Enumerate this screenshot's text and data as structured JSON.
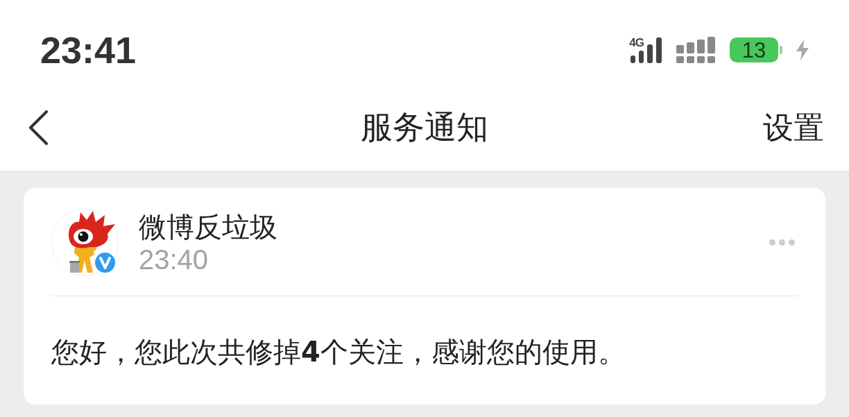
{
  "status_bar": {
    "time": "23:41",
    "network_type": "4G",
    "battery_percentage": "13",
    "charging": true
  },
  "nav_bar": {
    "title": "服务通知",
    "action": "设置"
  },
  "notifications": [
    {
      "sender": "微博反垃圾",
      "verified": true,
      "time": "23:40",
      "message": "您好，您此次共修掉**4**个关注，感谢您的使用。"
    }
  ]
}
